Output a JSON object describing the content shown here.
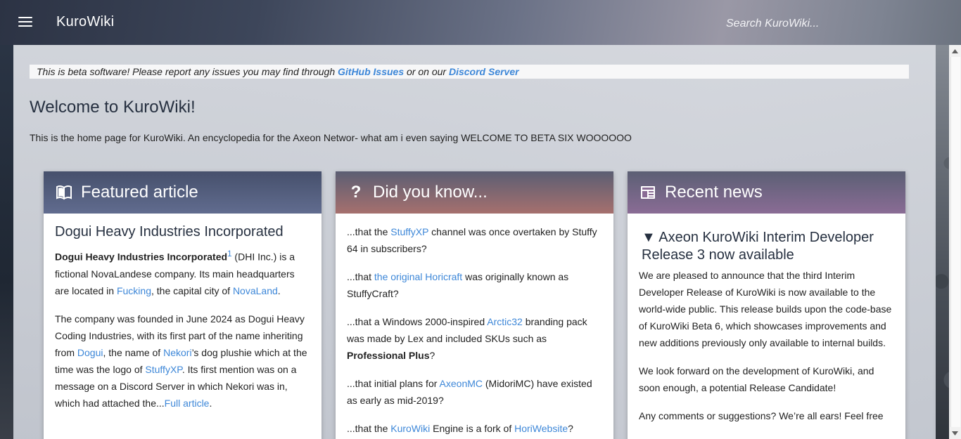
{
  "header": {
    "app_title": "KuroWiki",
    "search_placeholder": "Search KuroWiki..."
  },
  "beta_note": {
    "prefix": "This is beta software! Please report any issues you may find through ",
    "link1": "GitHub Issues",
    "middle": " or on our ",
    "link2": "Discord Server"
  },
  "welcome_title": "Welcome to KuroWiki!",
  "intro_text": "This is the home page for KuroWiki. An encyclopedia for the Axeon Networ- what am i even saying WELCOME TO BETA SIX WOOOOOO",
  "featured": {
    "header": "Featured article",
    "icon": "book-icon",
    "title": "Dogui Heavy Industries Incorporated",
    "p1": {
      "bold": "Dogui Heavy Industries Incorporated",
      "sup": "1",
      "t1": " (DHI Inc.) is a fictional NovaLandese company. Its main headquarters are located in ",
      "link1": "Fucking",
      "t2": ", the capital city of ",
      "link2": "NovaLand",
      "t3": "."
    },
    "p2": {
      "t1": "The company was founded in June 2024 as Dogui Heavy Coding Industries, with its first part of the name inheriting from ",
      "link1": "Dogui",
      "t2": ", the name of ",
      "link2": "Nekori",
      "t3": "’s dog plushie which at the time was the logo of ",
      "link3": "StuffyXP",
      "t4": ". Its first mention was on a message on a Discord Server in which Nekori was in, which had attached the...",
      "link4": "Full article",
      "t5": "."
    }
  },
  "didyouknow": {
    "header": "Did you know...",
    "icon": "question-icon",
    "f1": {
      "t1": "...that the ",
      "link": "StuffyXP",
      "t2": " channel was once overtaken by Stuffy 64 in subscribers?"
    },
    "f2": {
      "t1": "...that ",
      "link": "the original Horicraft",
      "t2": " was originally known as StuffyCraft?"
    },
    "f3": {
      "t1": "...that a Windows 2000-inspired ",
      "link": "Arctic32",
      "t2": " branding pack was made by Lex and included SKUs such as ",
      "bold": "Professional Plus",
      "t3": "?"
    },
    "f4": {
      "t1": "...that initial plans for ",
      "link": "AxeonMC",
      "t2": " (MidoriMC) have existed as early as mid-2019?"
    },
    "f5": {
      "t1": "...that the ",
      "link1": "KuroWiki",
      "t2": " Engine is a fork of ",
      "link2": "HoriWebsite",
      "t3": "?"
    }
  },
  "news": {
    "header": "Recent news",
    "icon": "newspaper-icon",
    "title_marker": "▼",
    "title": "Axeon KuroWiki Interim Developer Release 3 now available",
    "p1": "We are pleased to announce that the third Interim Developer Release of KuroWiki is now available to the world-wide public. This release builds upon the code-base of KuroWiki Beta 6, which showcases improvements and new additions previously only available to internal builds.",
    "p2": "We look forward on the development of KuroWiki, and soon enough, a potential Release Candidate!",
    "p3": "Any comments or suggestions? We’re all ears! Feel free"
  },
  "colors": {
    "link": "#3d87d8",
    "featured_header": "#616c8f",
    "dyk_header": "#a6706e",
    "news_header": "#8a6c95"
  }
}
